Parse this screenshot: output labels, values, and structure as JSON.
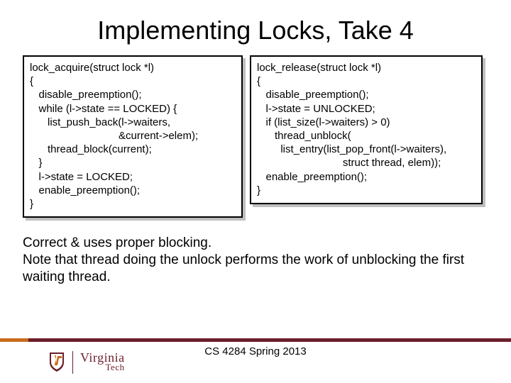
{
  "title": "Implementing Locks, Take 4",
  "code_left": "lock_acquire(struct lock *l)\n{\n   disable_preemption();\n   while (l->state == LOCKED) {\n      list_push_back(l->waiters,\n                              &current->elem);\n      thread_block(current);\n   }\n   l->state = LOCKED;\n   enable_preemption();\n}",
  "code_right": "lock_release(struct lock *l)\n{\n   disable_preemption();\n   l->state = UNLOCKED;\n   if (list_size(l->waiters) > 0)\n      thread_unblock(\n        list_entry(list_pop_front(l->waiters),\n                             struct thread, elem));\n   enable_preemption();\n}",
  "caption_line1": "Correct & uses proper blocking.",
  "caption_line2": "Note that thread doing the unlock performs the work of unblocking the first waiting thread.",
  "course": "CS 4284 Spring 2013",
  "logo": {
    "top": "Virginia",
    "bottom": "Tech"
  }
}
